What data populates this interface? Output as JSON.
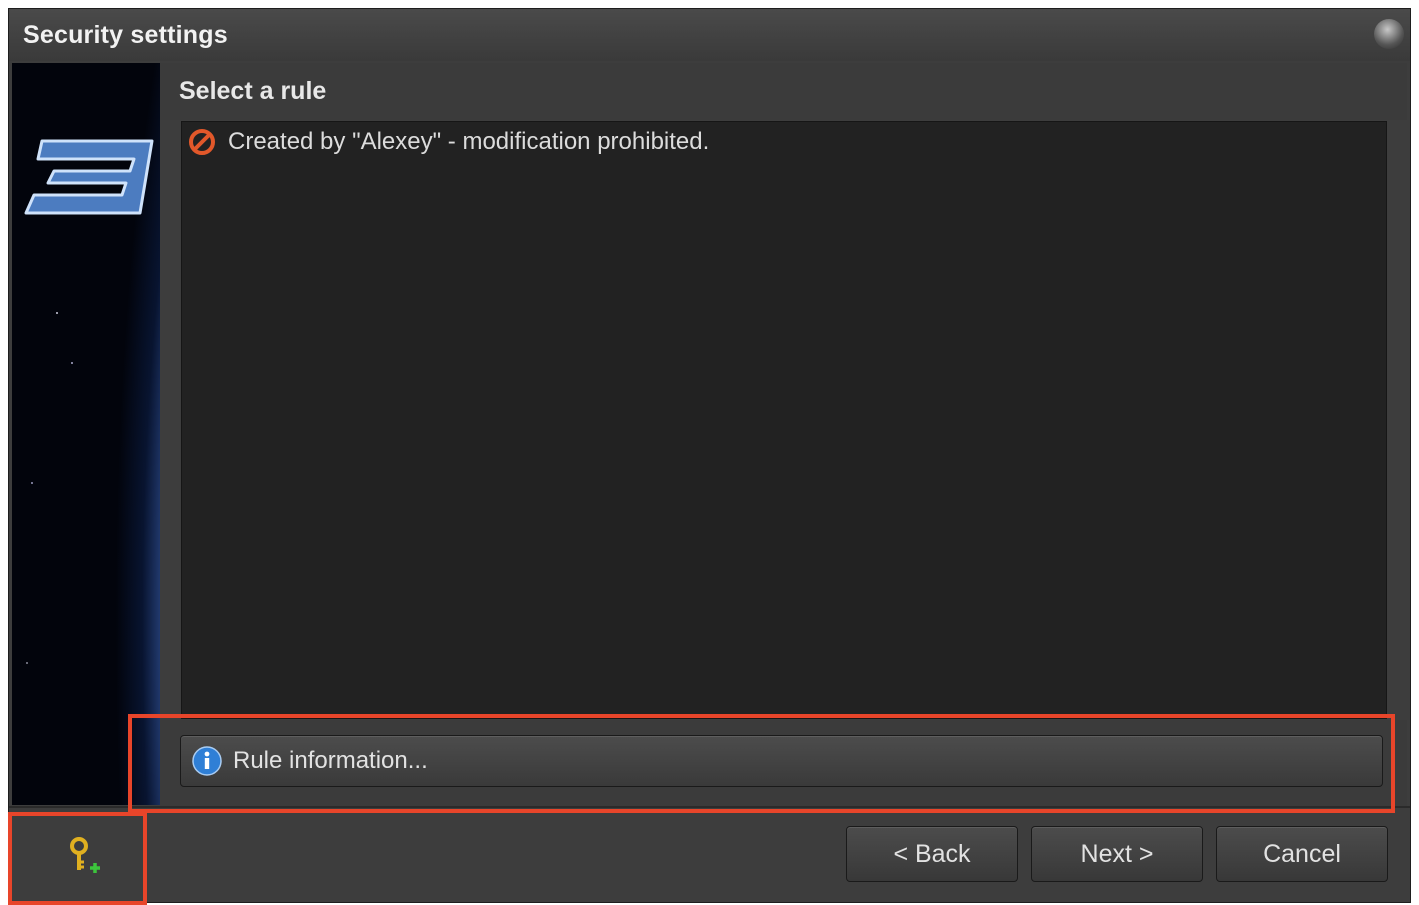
{
  "window": {
    "title": "Security settings"
  },
  "section": {
    "title": "Select a rule"
  },
  "rules": [
    {
      "icon": "prohibited-icon",
      "text": "Created by \"Alexey\" - modification prohibited."
    }
  ],
  "rule_info_button": {
    "icon": "info-icon",
    "label": "Rule information..."
  },
  "footer": {
    "key_icon": "add-key-icon",
    "back_label": "< Back",
    "next_label": "Next >",
    "cancel_label": "Cancel"
  },
  "colors": {
    "highlight": "#e8452a",
    "prohibited": "#e2582a",
    "info": "#2f7fd6",
    "key": "#e0b020",
    "key_plus": "#3cc43c"
  }
}
